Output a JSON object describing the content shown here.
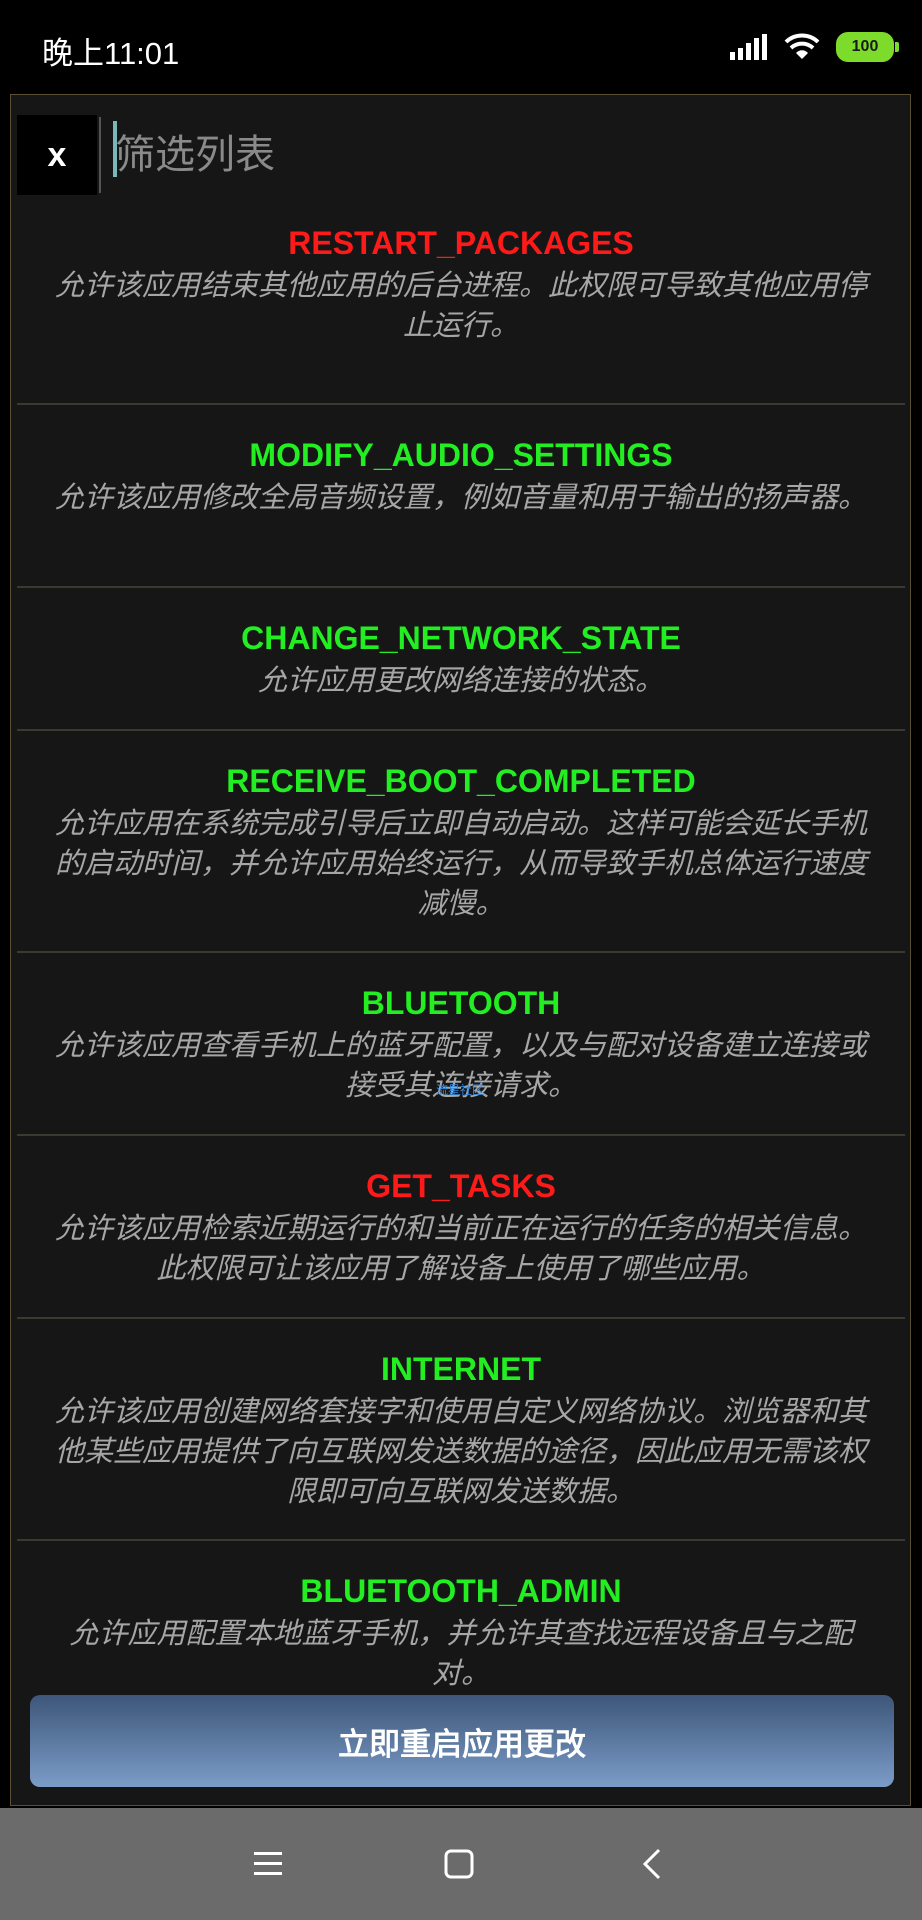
{
  "status_bar": {
    "time": "晚上11:01",
    "battery": "100",
    "icons": [
      "signal-icon",
      "wifi-icon",
      "battery-icon"
    ]
  },
  "filter": {
    "placeholder": "筛选列表",
    "close_label": "x"
  },
  "permissions": [
    {
      "name": "RESTART_PACKAGES",
      "color": "#ff1a1a",
      "desc": "允许该应用结束其他应用的后台进程。此权限可导致其他应用停止运行。"
    },
    {
      "name": "MODIFY_AUDIO_SETTINGS",
      "color": "#22ee22",
      "desc": "允许该应用修改全局音频设置，例如音量和用于输出的扬声器。"
    },
    {
      "name": "CHANGE_NETWORK_STATE",
      "color": "#22ee22",
      "desc": "允许应用更改网络连接的状态。"
    },
    {
      "name": "RECEIVE_BOOT_COMPLETED",
      "color": "#22ee22",
      "desc": "允许应用在系统完成引导后立即自动启动。这样可能会延长手机的启动时间，并允许应用始终运行，从而导致手机总体运行速度减慢。"
    },
    {
      "name": "BLUETOOTH",
      "color": "#22ee22",
      "desc": "允许该应用查看手机上的蓝牙配置，以及与配对设备建立连接或接受其连接请求。"
    },
    {
      "name": "GET_TASKS",
      "color": "#ff1a1a",
      "desc": "允许该应用检索近期运行的和当前正在运行的任务的相关信息。此权限可让该应用了解设备上使用了哪些应用。"
    },
    {
      "name": "INTERNET",
      "color": "#22ee22",
      "desc": "允许该应用创建网络套接字和使用自定义网络协议。浏览器和其他某些应用提供了向互联网发送数据的途径，因此应用无需该权限即可向互联网发送数据。"
    },
    {
      "name": "BLUETOOTH_ADMIN",
      "color": "#22ee22",
      "desc": "允许应用配置本地蓝牙手机，并允许其查找远程设备且与之配对。"
    }
  ],
  "watermark": "流星社区",
  "restart_button": "立即重启应用更改",
  "nav": [
    "menu-icon",
    "home-icon",
    "back-icon"
  ]
}
